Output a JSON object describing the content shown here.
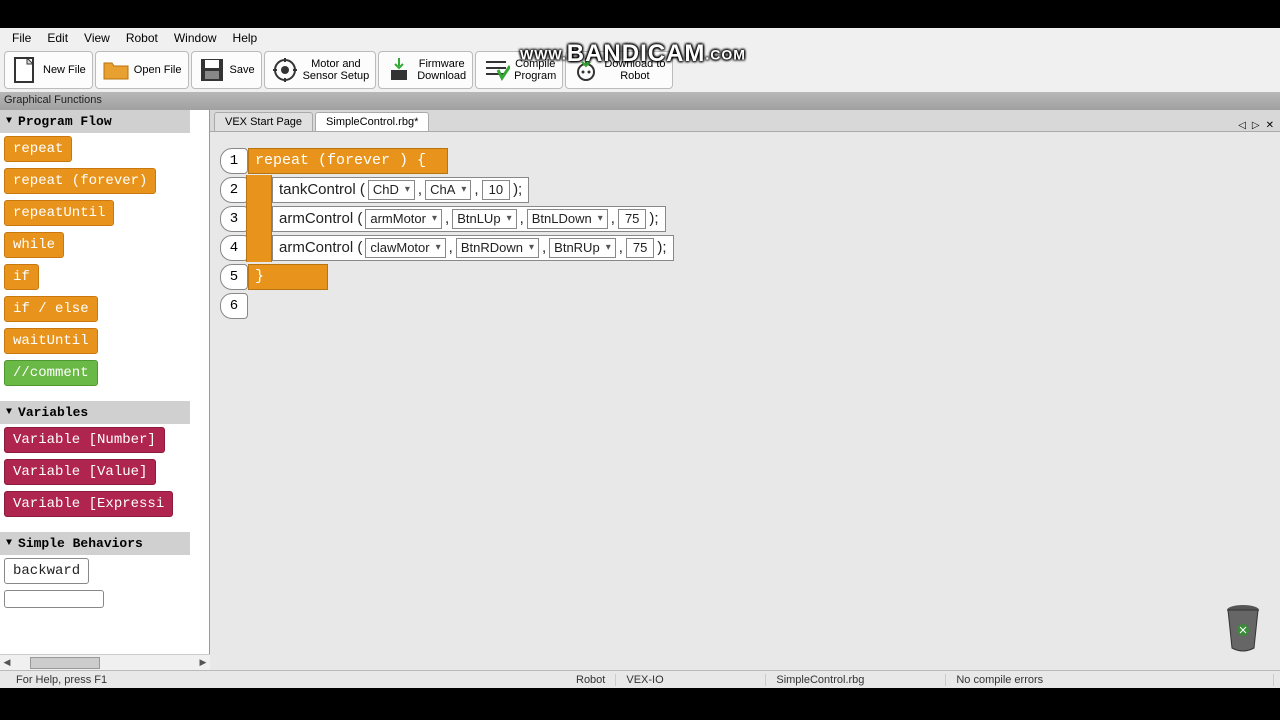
{
  "watermark": "WWW.BANDICAM.COM",
  "menubar": [
    "File",
    "Edit",
    "View",
    "Robot",
    "Window",
    "Help"
  ],
  "toolbar": [
    {
      "label": "New File",
      "icon": "newfile"
    },
    {
      "label": "Open File",
      "icon": "openfile"
    },
    {
      "label": "Save",
      "icon": "save"
    },
    {
      "label": "Motor and\nSensor Setup",
      "icon": "motor"
    },
    {
      "label": "Firmware\nDownload",
      "icon": "firmware"
    },
    {
      "label": "Compile\nProgram",
      "icon": "compile"
    },
    {
      "label": "Download to\nRobot",
      "icon": "download"
    }
  ],
  "pane_title": "Graphical Functions",
  "categories": [
    {
      "name": "Program Flow",
      "blocks": [
        {
          "text": "repeat",
          "cls": "orange"
        },
        {
          "text": "repeat (forever)",
          "cls": "orange"
        },
        {
          "text": "repeatUntil",
          "cls": "orange"
        },
        {
          "text": "while",
          "cls": "orange"
        },
        {
          "text": "if",
          "cls": "orange"
        },
        {
          "text": "if / else",
          "cls": "orange"
        },
        {
          "text": "waitUntil",
          "cls": "orange"
        },
        {
          "text": "//comment",
          "cls": "green"
        }
      ]
    },
    {
      "name": "Variables",
      "blocks": [
        {
          "text": "Variable [Number]",
          "cls": "crimson"
        },
        {
          "text": "Variable [Value]",
          "cls": "crimson"
        },
        {
          "text": "Variable [Expressi",
          "cls": "crimson"
        }
      ]
    },
    {
      "name": "Simple Behaviors",
      "blocks": [
        {
          "text": "backward",
          "cls": "white"
        },
        {
          "text": "",
          "cls": "white"
        }
      ]
    }
  ],
  "tabs": [
    {
      "label": "VEX Start Page",
      "active": false
    },
    {
      "label": "SimpleControl.rbg*",
      "active": true
    }
  ],
  "code": {
    "line1": "repeat (forever ) {",
    "line2": {
      "fn": "tankControl (",
      "args": [
        "ChD",
        "ChA"
      ],
      "num": "10",
      "end": ");"
    },
    "line3": {
      "fn": "armControl (",
      "args": [
        "armMotor",
        "BtnLUp",
        "BtnLDown"
      ],
      "num": "75",
      "end": ");"
    },
    "line4": {
      "fn": "armControl (",
      "args": [
        "clawMotor",
        "BtnRDown",
        "BtnRUp"
      ],
      "num": "75",
      "end": ");"
    },
    "line5": "}",
    "comma": ","
  },
  "statusbar": {
    "help": "For Help, press F1",
    "robot": "Robot",
    "platform": "VEX-IO",
    "file": "SimpleControl.rbg",
    "compile": "No compile errors"
  }
}
